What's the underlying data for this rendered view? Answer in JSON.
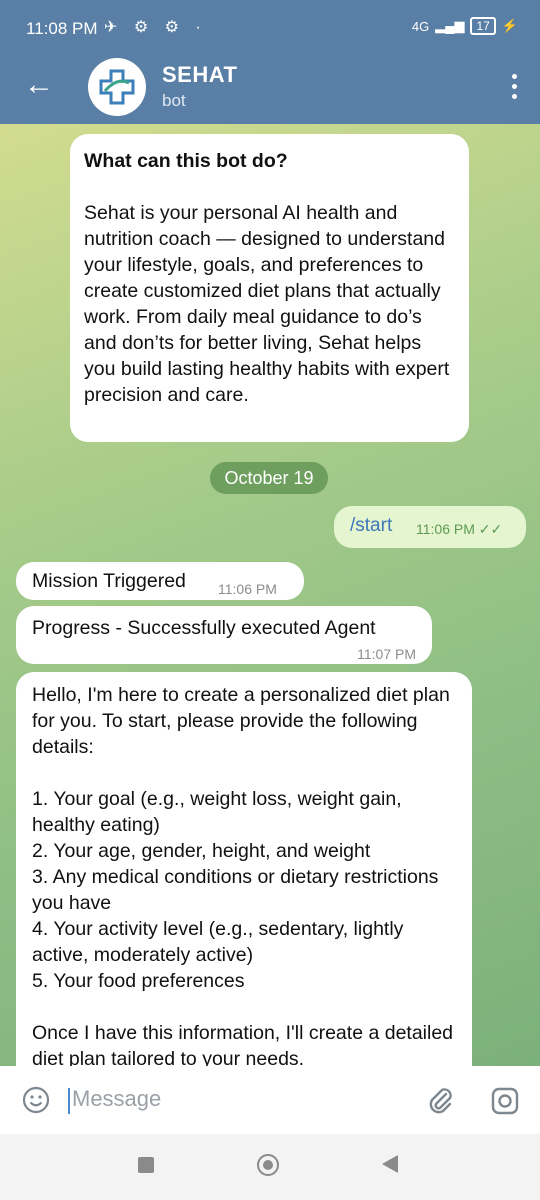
{
  "status": {
    "time": "11:08 PM",
    "icons_left": "✈ ⚙ ⚙ ·",
    "network": "4G",
    "battery": "17"
  },
  "header": {
    "back_icon": "back-arrow-icon",
    "title": "SEHAT",
    "subtitle": "bot"
  },
  "intro": {
    "question": "What can this bot do?",
    "body": "Sehat is your personal AI health and nutrition coach — designed to understand your lifestyle, goals, and preferences to create customized diet plans that actually work. From daily meal guidance to do’s and don’ts for better living, Sehat helps you build lasting healthy habits with expert precision and care."
  },
  "date_chip": "October 19",
  "outgoing": {
    "text": "/start",
    "time": "11:06 PM"
  },
  "messages": [
    {
      "text": "Mission Triggered",
      "time": "11:06 PM"
    },
    {
      "text": "Progress - Successfully executed Agent",
      "time": "11:07 PM"
    },
    {
      "text": "Hello, I'm here to create a personalized diet plan for you. To start, please provide the following details:\n\n1.  Your goal (e.g., weight loss, weight gain, healthy eating)\n2.  Your age, gender, height, and weight\n3.  Any medical conditions or dietary restrictions you have\n4.  Your activity level (e.g., sedentary, lightly active, moderately active)\n5.  Your food preferences\n\nOnce I have this information, I'll create a detailed diet plan tailored to your needs."
    }
  ],
  "input": {
    "placeholder": "Message"
  },
  "colors": {
    "header": "#5a7fa6",
    "outgoing": "#e4f5cf",
    "date_chip": "#6e9f5e"
  }
}
